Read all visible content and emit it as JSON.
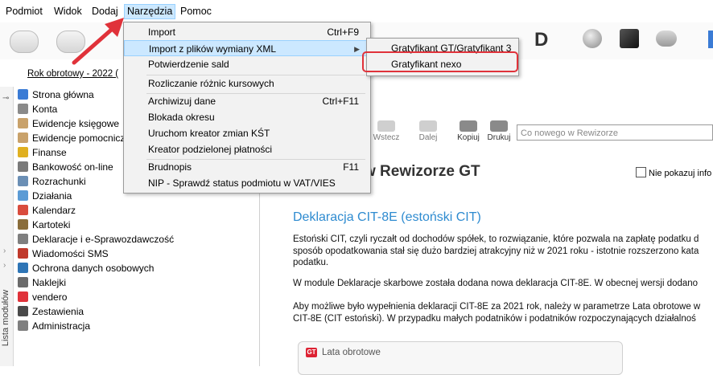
{
  "menubar": {
    "items": [
      "Podmiot",
      "Widok",
      "Dodaj",
      "Narzędzia",
      "Pomoc"
    ]
  },
  "toolbar": {
    "d_label": "D"
  },
  "left": {
    "year_label": "Rok obrotowy - 2022  (",
    "sidebar_label": "Lista modułów",
    "modules": [
      {
        "label": "Strona główna",
        "icon": "home-icon",
        "color": "#3a7bd5"
      },
      {
        "label": "Konta",
        "icon": "book-icon",
        "color": "#8a8a8a"
      },
      {
        "label": "Ewidencje księgowe",
        "icon": "ledger-icon",
        "color": "#c9a26b"
      },
      {
        "label": "Ewidencje pomocnicze",
        "icon": "ledger-icon",
        "color": "#c9a26b"
      },
      {
        "label": "Finanse",
        "icon": "coins-icon",
        "color": "#e0b020"
      },
      {
        "label": "Bankowość on-line",
        "icon": "bank-icon",
        "color": "#7a7a7a"
      },
      {
        "label": "Rozrachunki",
        "icon": "handshake-icon",
        "color": "#6b8fb5"
      },
      {
        "label": "Działania",
        "icon": "gears-icon",
        "color": "#5b9bd5"
      },
      {
        "label": "Kalendarz",
        "icon": "calendar-icon",
        "color": "#d94c3d"
      },
      {
        "label": "Kartoteki",
        "icon": "cards-icon",
        "color": "#8a6d3b"
      },
      {
        "label": "Deklaracje i e-Sprawozdawczość",
        "icon": "declaration-icon",
        "color": "#7f7f7f"
      },
      {
        "label": "Wiadomości SMS",
        "icon": "sms-icon",
        "color": "#c0392b"
      },
      {
        "label": "Ochrona danych osobowych",
        "icon": "shield-icon",
        "color": "#2e75b6"
      },
      {
        "label": "Naklejki",
        "icon": "sticker-icon",
        "color": "#6b6b6b"
      },
      {
        "label": "vendero",
        "icon": "vendero-icon",
        "color": "#e0323a"
      },
      {
        "label": "Zestawienia",
        "icon": "chart-icon",
        "color": "#4a4a4a"
      },
      {
        "label": "Administracja",
        "icon": "admin-icon",
        "color": "#7f7f7f"
      }
    ]
  },
  "dropdown": {
    "items": [
      {
        "label": "Import",
        "shortcut": "Ctrl+F9"
      },
      {
        "label": "Import z plików wymiany XML",
        "shortcut": ""
      },
      {
        "label": "Potwierdzenie sald",
        "shortcut": ""
      },
      {
        "label": "Rozliczanie różnic kursowych",
        "shortcut": ""
      },
      {
        "label": "Archiwizuj dane",
        "shortcut": "Ctrl+F11"
      },
      {
        "label": "Blokada okresu",
        "shortcut": ""
      },
      {
        "label": "Uruchom kreator zmian KŚT",
        "shortcut": ""
      },
      {
        "label": "Kreator podzielonej płatności",
        "shortcut": ""
      },
      {
        "label": "Brudnopis",
        "shortcut": "F11"
      },
      {
        "label": "NIP - Sprawdź status podmiotu w VAT/VIES",
        "shortcut": ""
      }
    ]
  },
  "submenu": {
    "items": [
      "Gratyfikant GT/Gratyfikant 3",
      "Gratyfikant nexo"
    ]
  },
  "content": {
    "nav": [
      "Wstecz",
      "Dalej",
      "Kopiuj",
      "Drukuj"
    ],
    "search_placeholder": "Co nowego w Rewizorze",
    "heading": "w Rewizorze GT",
    "no_show": "Nie pokazuj info",
    "article_title": "Deklaracja CIT-8E (estoński CIT)",
    "paragraphs": [
      "Estoński CIT, czyli ryczałt od dochodów spółek, to rozwiązanie, które pozwala na zapłatę podatku d",
      "sposób opodatkowania stał się dużo bardziej atrakcyjny niż w 2021 roku - istotnie rozszerzono kata",
      "podatku.",
      "W module Deklaracje skarbowe została dodana nowa deklaracja CIT-8E. W obecnej wersji dodano",
      "Aby możliwe było wypełnienia deklaracji CIT-8E za 2021 rok, należy w parametrze Lata obrotowe w",
      "CIT-8E (CIT estoński). W przypadku małych podatników i podatników rozpoczynających działalnoś"
    ],
    "lata_title": "Lata obrotowe",
    "gt_logo": "GT"
  },
  "colors": {
    "accent": "#2e8bd0",
    "highlight": "#cce8ff",
    "annotation": "#e0323a"
  }
}
